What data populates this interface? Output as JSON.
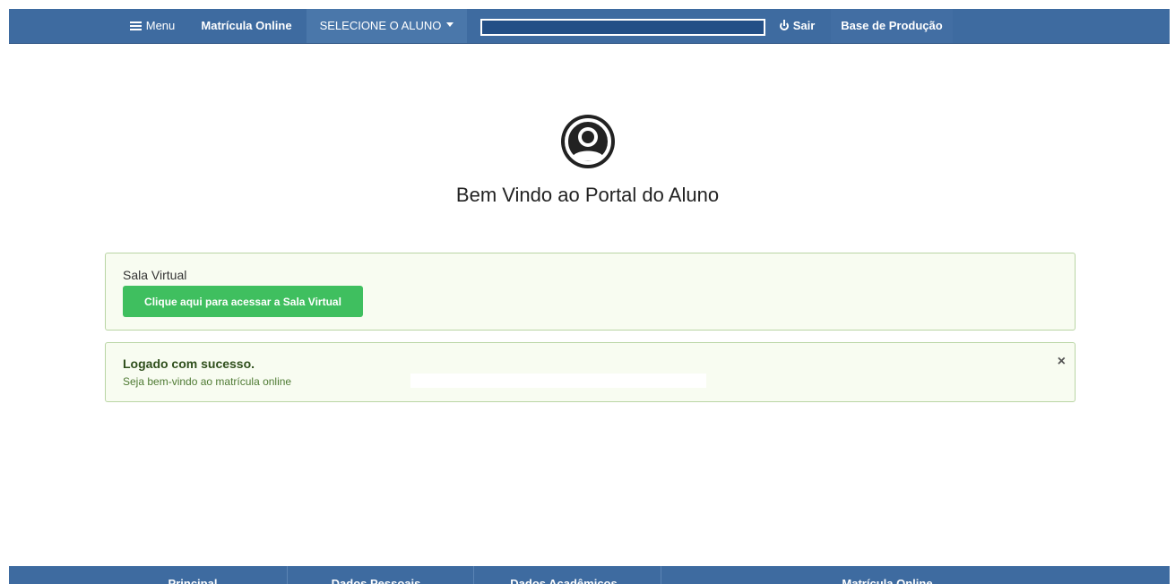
{
  "topbar": {
    "menu_label": "Menu",
    "app_name": "Matrícula Online",
    "select_student": "SELECIONE O ALUNO",
    "logout": "Sair",
    "env": "Base de Produção"
  },
  "welcome": {
    "title": "Bem Vindo ao Portal do Aluno"
  },
  "sala_virtual": {
    "label": "Sala Virtual",
    "button": "Clique aqui para acessar a Sala Virtual"
  },
  "alert": {
    "title": "Logado com sucesso.",
    "message": "Seja bem-vindo ao matrícula online",
    "close": "×"
  },
  "footer": {
    "items": [
      "Principal",
      "Dados Pessoais",
      "Dados Acadêmicos",
      "Matrícula Online"
    ]
  },
  "colors": {
    "nav": "#3e6ba0",
    "button": "#3fbf5f",
    "alert_bg": "#f8fcf1"
  },
  "icons": [
    "hamburger-icon",
    "caret-down-icon",
    "power-icon",
    "user-avatar-icon",
    "close-icon"
  ]
}
